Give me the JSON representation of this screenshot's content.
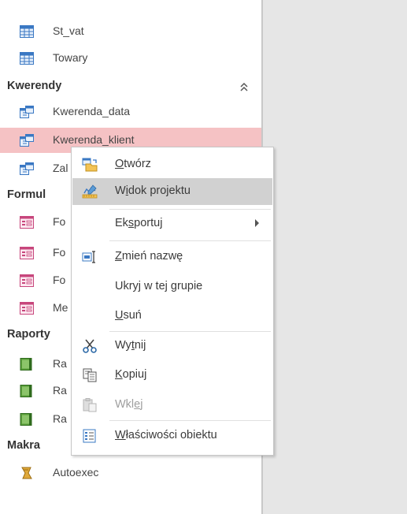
{
  "nav": {
    "items_top": [
      {
        "label": "St_vat"
      },
      {
        "label": "Towary"
      }
    ],
    "groups": {
      "kwerendy": {
        "title": "Kwerendy",
        "collapse_glyph": "‸‸"
      },
      "formularze": {
        "title": "Formul"
      },
      "raporty": {
        "title": "Raporty"
      },
      "makra": {
        "title": "Makra"
      }
    },
    "queries": [
      {
        "label": "Kwerenda_data"
      },
      {
        "label": "Kwerenda_klient"
      },
      {
        "label": "Zal"
      }
    ],
    "forms": [
      {
        "label": "Fo"
      },
      {
        "label": "Fo"
      },
      {
        "label": "Fo"
      },
      {
        "label": "Me"
      }
    ],
    "reports": [
      {
        "label": "Ra"
      },
      {
        "label": "Ra"
      },
      {
        "label": "Ra"
      }
    ],
    "macros": [
      {
        "label": "Autoexec"
      }
    ]
  },
  "context_menu": {
    "open": {
      "pre": "",
      "key": "O",
      "post": "twórz"
    },
    "design_view": {
      "pre": "W",
      "key": "i",
      "post": "dok projektu"
    },
    "export": {
      "pre": "Ek",
      "key": "s",
      "post": "portuj"
    },
    "rename": {
      "pre": "",
      "key": "Z",
      "post": "mień nazwę"
    },
    "hide": {
      "pre": "Ukryj w tej ",
      "key": "g",
      "post": "rupie"
    },
    "delete": {
      "pre": "",
      "key": "U",
      "post": "suń"
    },
    "cut": {
      "pre": "Wy",
      "key": "t",
      "post": "nij"
    },
    "copy": {
      "pre": "",
      "key": "K",
      "post": "opiuj"
    },
    "paste": {
      "pre": "Wkl",
      "key": "e",
      "post": "j"
    },
    "properties": {
      "pre": "",
      "key": "W",
      "post": "łaściwości obiektu"
    }
  },
  "colors": {
    "selected_row": "#f5c2c4",
    "menu_hover": "#d1d1d1",
    "workspace": "#e6e6e6"
  }
}
